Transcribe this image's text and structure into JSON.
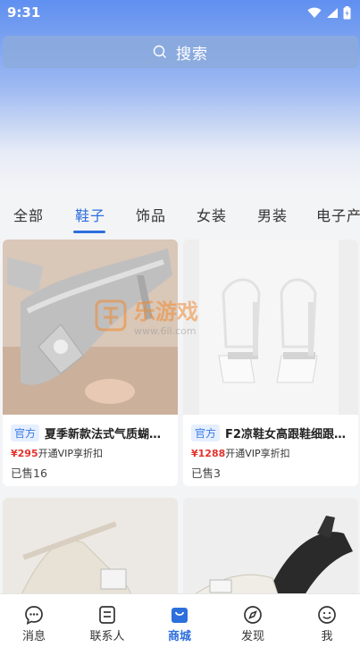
{
  "status_bar": {
    "time": "9:31"
  },
  "search": {
    "placeholder_label": "搜索"
  },
  "tabs": [
    {
      "label": "全部"
    },
    {
      "label": "鞋子",
      "active": true
    },
    {
      "label": "饰品"
    },
    {
      "label": "女装"
    },
    {
      "label": "男装"
    },
    {
      "label": "电子产"
    }
  ],
  "products": [
    {
      "badge": "官方",
      "title": "夏季新款法式气质蝴…",
      "price": "¥295",
      "vip_text": "开通VIP享折扣",
      "sold": "已售16"
    },
    {
      "badge": "官方",
      "title": "F2凉鞋女高跟鞋细跟…",
      "price": "¥1288",
      "vip_text": "开通VIP享折扣",
      "sold": "已售3"
    },
    {
      "badge": "",
      "title": "",
      "price": "",
      "vip_text": "",
      "sold": ""
    },
    {
      "badge": "",
      "title": "",
      "price": "",
      "vip_text": "",
      "sold": ""
    }
  ],
  "watermark": {
    "text": "乐游戏",
    "url": "www.6ll.com"
  },
  "bottom_nav": [
    {
      "label": "消息",
      "icon": "message-icon"
    },
    {
      "label": "联系人",
      "icon": "contacts-icon"
    },
    {
      "label": "商城",
      "icon": "shop-icon",
      "active": true
    },
    {
      "label": "发现",
      "icon": "compass-icon"
    },
    {
      "label": "我",
      "icon": "smile-icon"
    }
  ],
  "colors": {
    "accent": "#2d6fdc",
    "price": "#e5322d",
    "badge_bg": "#e6efff"
  }
}
